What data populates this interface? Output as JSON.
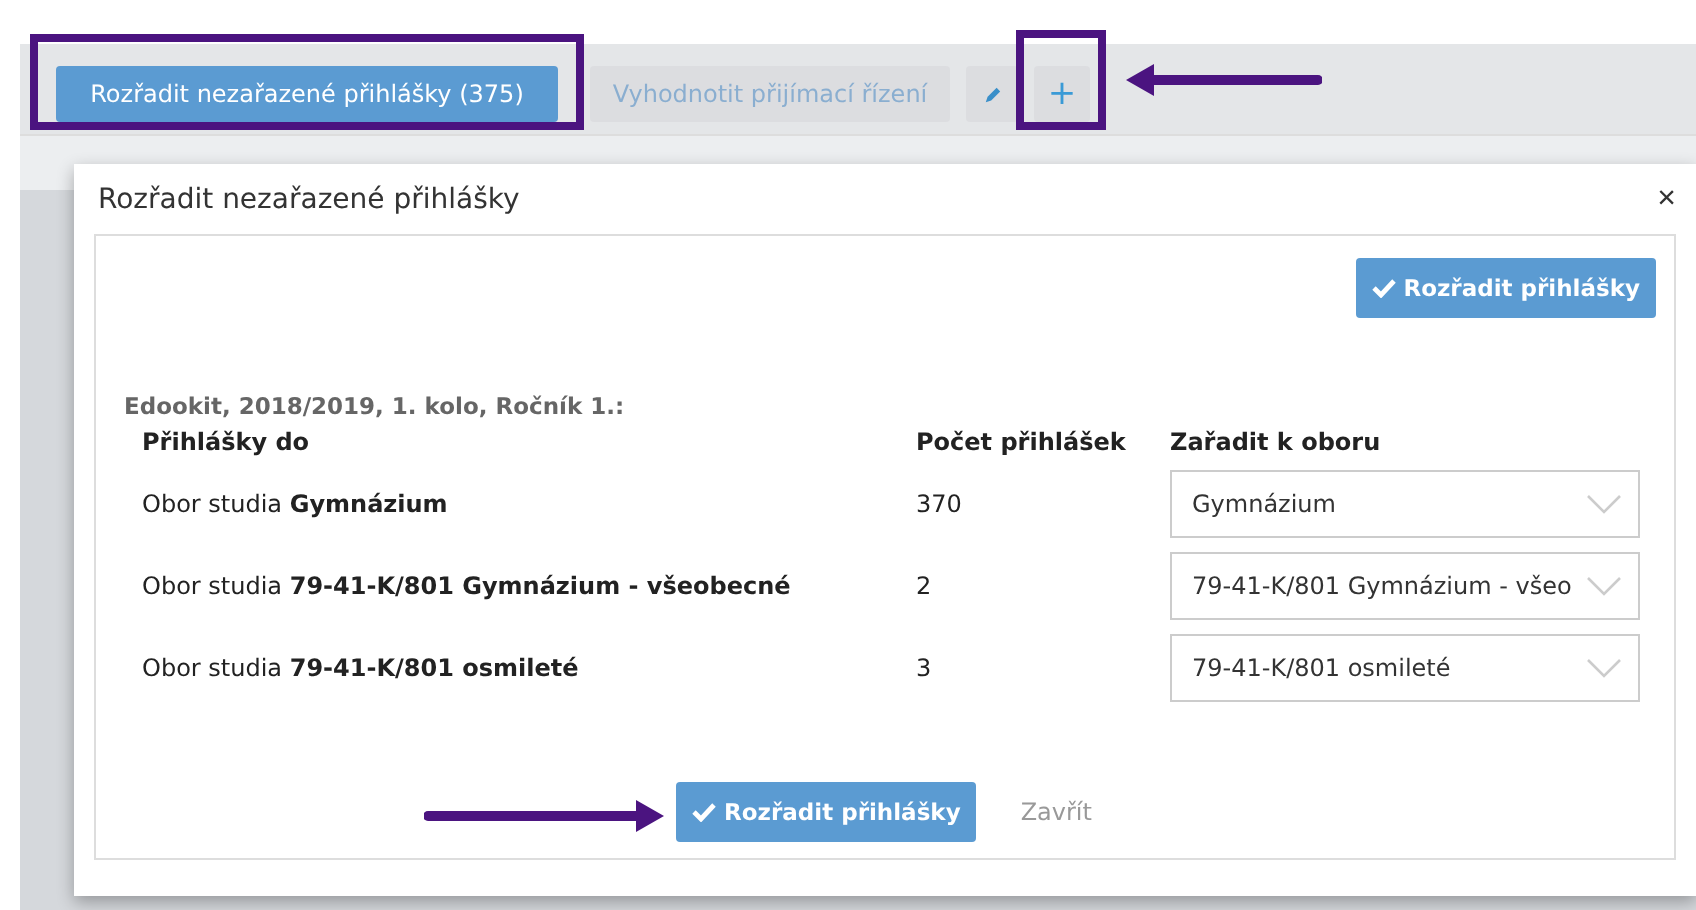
{
  "toolbar": {
    "buttons": [
      {
        "kind": "primary",
        "label": "Rozřadit nezařazené přihlášky (375)"
      },
      {
        "kind": "secondary",
        "label": "Vyhodnotit přijímací řízení"
      },
      {
        "kind": "pencil"
      },
      {
        "kind": "plus",
        "label": "+"
      }
    ]
  },
  "modal": {
    "title": "Rozřadit nezařazené přihlášky",
    "close": "×",
    "top_button": "Rozřadit přihlášky",
    "group_label": "Edookit, 2018/2019, 1. kolo, Ročník 1.:",
    "columns": [
      "Přihlášky do",
      "Počet přihlášek",
      "Zařadit k oboru"
    ],
    "rows": [
      {
        "label": "Obor studia **Gymnázium**",
        "count": "370",
        "field": "Gymnázium"
      },
      {
        "label": "Obor studia **79-41-K/801 Gymnázium - všeobecné**",
        "count": "2",
        "field": "79-41-K/801 Gymnázium - všeo"
      },
      {
        "label": "Obor studia **79-41-K/801 osmileté**",
        "count": "3",
        "field": "79-41-K/801 osmileté"
      }
    ],
    "footer": {
      "submit": "Rozřadit přihlášky",
      "close": "Zavřít"
    }
  }
}
